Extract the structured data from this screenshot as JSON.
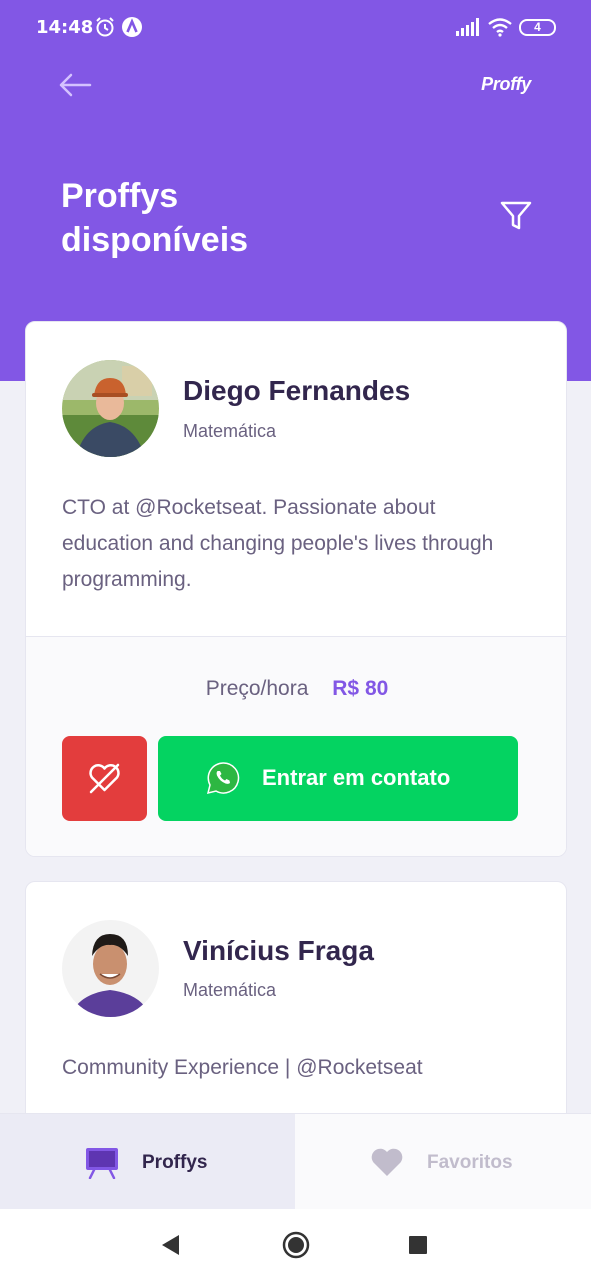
{
  "status_bar": {
    "time": "14:48",
    "icons": [
      "alarm-icon",
      "app-a-icon",
      "signal-icon",
      "wifi-icon",
      "battery-icon"
    ],
    "battery": "4"
  },
  "header": {
    "back_icon": "arrow-left-icon",
    "brand": "Proffy",
    "title": "Proffys disponíveis",
    "filter_icon": "filter-icon",
    "background": "#8257E5"
  },
  "teachers": [
    {
      "name": "Diego Fernandes",
      "subject": "Matemática",
      "bio": "CTO at @Rocketseat. Passionate about education and changing people's lives through programming.",
      "price_label": "Preço/hora",
      "price_value": "R$ 80",
      "favorite_icon": "heart-off-icon",
      "contact_icon": "whatsapp-icon",
      "contact_label": "Entrar em contato"
    },
    {
      "name": "Vinícius Fraga",
      "subject": "Matemática",
      "bio": "Community Experience | @Rocketseat"
    }
  ],
  "tabs": [
    {
      "label": "Proffys",
      "icon": "easel-icon",
      "active": true
    },
    {
      "label": "Favoritos",
      "icon": "heart-icon",
      "active": false
    }
  ],
  "system_nav": [
    "back-triangle-icon",
    "home-circle-icon",
    "recents-square-icon"
  ],
  "colors": {
    "primary": "#8257E5",
    "favorite_button": "#E33D3D",
    "contact_button": "#04D361",
    "title_text": "#32264D",
    "body_text": "#6A6180"
  }
}
